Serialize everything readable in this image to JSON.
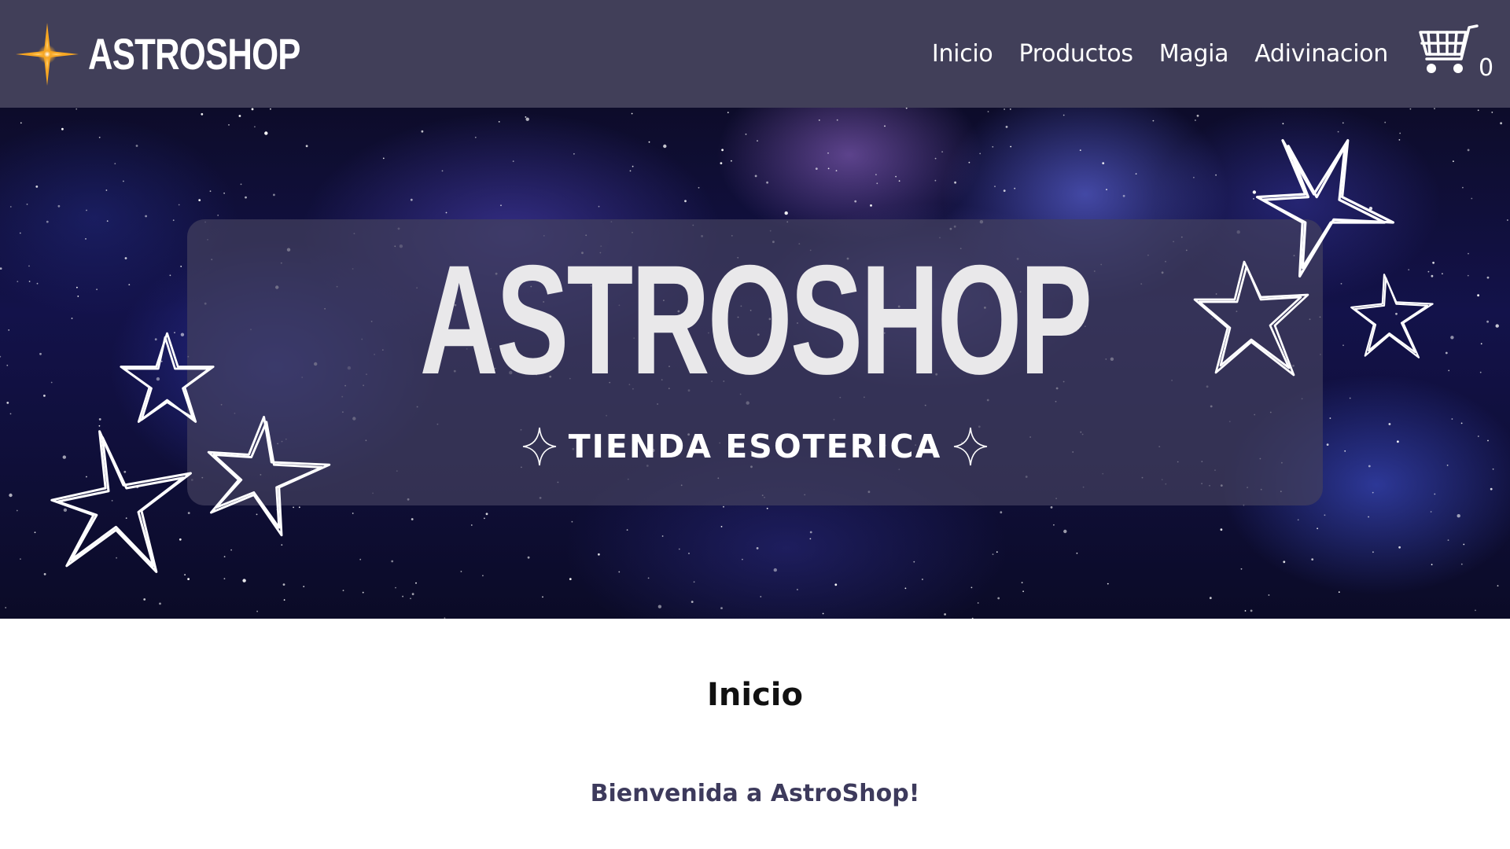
{
  "header": {
    "brand_name": "ASTROSHOP",
    "brand_icon": "four-point-star-icon",
    "nav": [
      {
        "label": "Inicio"
      },
      {
        "label": "Productos"
      },
      {
        "label": "Magia"
      },
      {
        "label": "Adivinacion"
      }
    ],
    "cart_icon": "shopping-cart-icon",
    "cart_count": "0"
  },
  "hero": {
    "title": "ASTROSHOP",
    "subtitle": "TIENDA ESOTERICA"
  },
  "main": {
    "heading": "Inicio",
    "welcome": "Bienvenida a AstroShop!"
  },
  "colors": {
    "navbar_bg": "#413f59",
    "brand_star": "#f6a623",
    "welcome_text": "#3d3a5c",
    "hero_panel": "#42405e"
  }
}
